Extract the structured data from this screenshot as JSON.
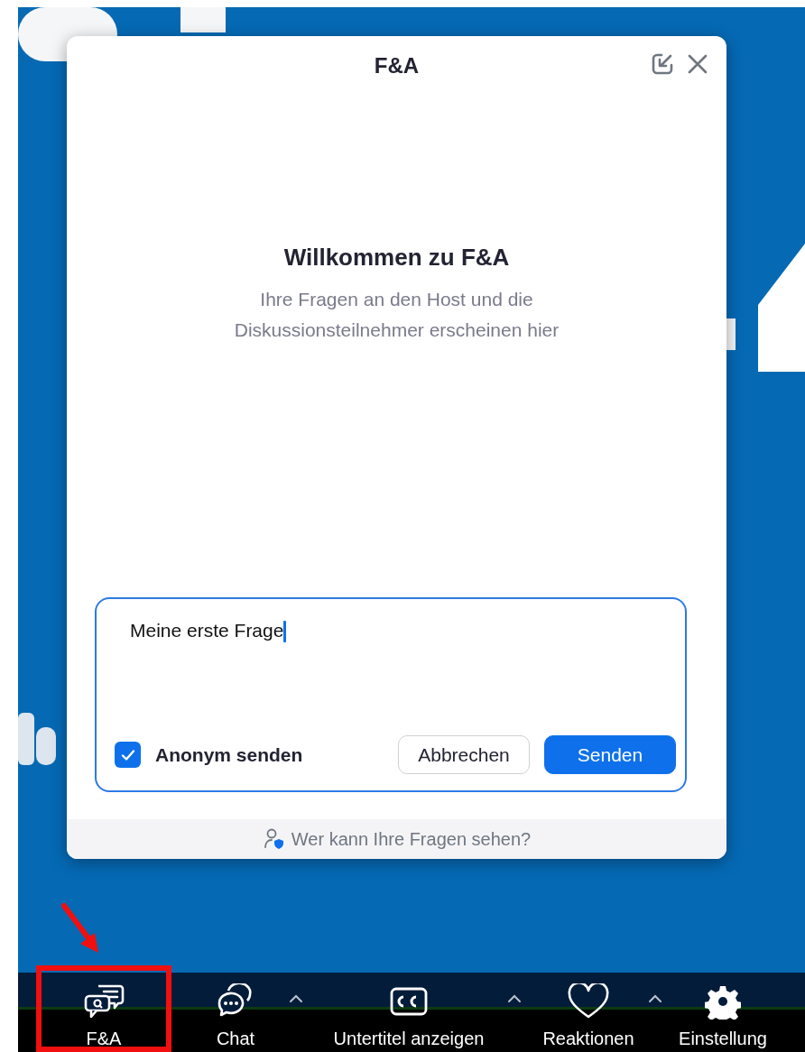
{
  "dialog": {
    "title": "F&A",
    "welcome_title": "Willkommen zu F&A",
    "welcome_text": "Ihre Fragen an den Host und die Diskussionsteilnehmer erscheinen hier",
    "question": {
      "value": "Meine erste Frage",
      "focused": true
    },
    "anonymous": {
      "label": "Anonym senden",
      "checked": true
    },
    "buttons": [
      {
        "label": "Abbrechen",
        "kind": "secondary"
      },
      {
        "label": "Senden",
        "kind": "primary"
      }
    ],
    "footer_link": "Wer kann Ihre Fragen sehen?"
  },
  "toolbar": [
    {
      "label": "F&A",
      "has_menu": false,
      "highlighted": true
    },
    {
      "label": "Chat",
      "has_menu": true,
      "highlighted": false
    },
    {
      "label": "Untertitel anzeigen",
      "has_menu": true,
      "highlighted": false
    },
    {
      "label": "Reaktionen",
      "has_menu": true,
      "highlighted": false
    },
    {
      "label": "Einstellung",
      "has_menu": false,
      "highlighted": false
    }
  ]
}
